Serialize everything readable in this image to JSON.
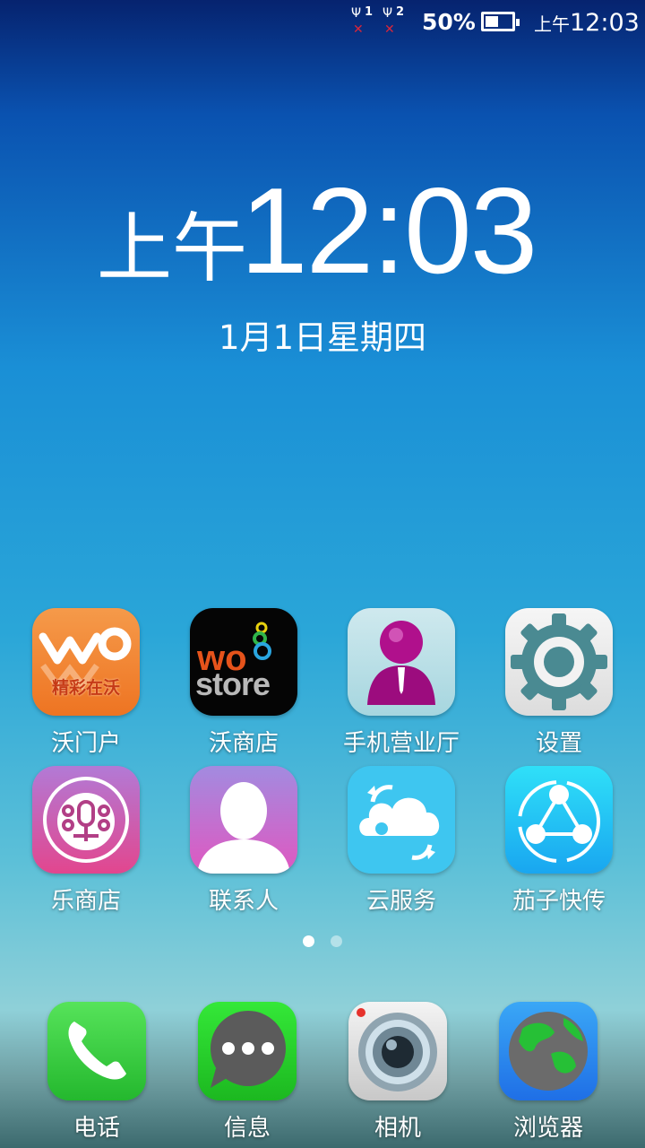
{
  "status_bar": {
    "sim1": "1",
    "sim2": "2",
    "battery_percent": "50%",
    "battery_level": 0.5,
    "time_ampm": "上午",
    "time": "12:03"
  },
  "lockclock": {
    "ampm": "上午",
    "time": "12:03",
    "date": "1月1日星期四"
  },
  "apps_row1": [
    {
      "label": "沃门户",
      "icon": "wo-portal-icon",
      "icon_text": "精彩在沃"
    },
    {
      "label": "沃商店",
      "icon": "wo-store-icon",
      "icon_text_top": "wo",
      "icon_text_bottom": "store"
    },
    {
      "label": "手机营业厅",
      "icon": "mobile-service-hall-icon"
    },
    {
      "label": "设置",
      "icon": "gear-icon"
    }
  ],
  "apps_row2": [
    {
      "label": "乐商店",
      "icon": "le-store-icon"
    },
    {
      "label": "联系人",
      "icon": "contacts-icon"
    },
    {
      "label": "云服务",
      "icon": "cloud-sync-icon"
    },
    {
      "label": "茄子快传",
      "icon": "share-transfer-icon"
    }
  ],
  "page_indicator": {
    "pages": 2,
    "active": 0
  },
  "dock": [
    {
      "label": "电话",
      "icon": "phone-icon"
    },
    {
      "label": "信息",
      "icon": "message-icon"
    },
    {
      "label": "相机",
      "icon": "camera-icon"
    },
    {
      "label": "浏览器",
      "icon": "browser-globe-icon"
    }
  ],
  "colors": {
    "phone_green": "#3fd03f",
    "message_green": "#2fd12f",
    "browser_blue": "#2a8df0",
    "cloud_cyan": "#3ec6f0",
    "signal_x_red": "#d8263a"
  }
}
